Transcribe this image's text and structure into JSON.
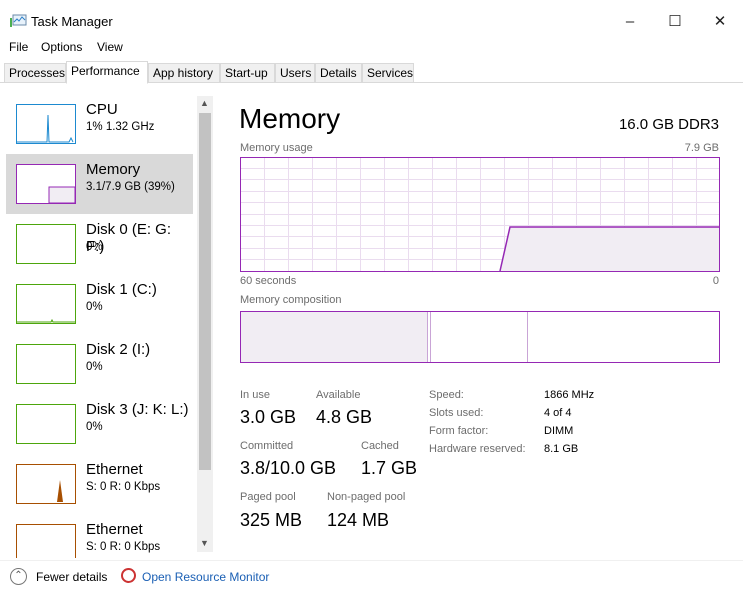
{
  "window": {
    "title": "Task Manager",
    "icon": "task-manager-icon"
  },
  "menu": [
    "File",
    "Options",
    "View"
  ],
  "tabs": [
    "Processes",
    "Performance",
    "App history",
    "Start-up",
    "Users",
    "Details",
    "Services"
  ],
  "active_tab": "Performance",
  "sidebar": [
    {
      "name": "CPU",
      "sub": "1% 1.32 GHz",
      "color": "#1d8ad0"
    },
    {
      "name": "Memory",
      "sub": "3.1/7.9 GB (39%)",
      "color": "#9528b4",
      "selected": true
    },
    {
      "name": "Disk 0 (E: G: F:)",
      "sub": "0%",
      "color": "#4da60c"
    },
    {
      "name": "Disk 1 (C:)",
      "sub": "0%",
      "color": "#4da60c"
    },
    {
      "name": "Disk 2 (I:)",
      "sub": "0%",
      "color": "#4da60c"
    },
    {
      "name": "Disk 3 (J: K: L:)",
      "sub": "0%",
      "color": "#4da60c"
    },
    {
      "name": "Ethernet",
      "sub": "S: 0 R: 0 Kbps",
      "color": "#a74f01"
    },
    {
      "name": "Ethernet",
      "sub": "S: 0 R: 0 Kbps",
      "color": "#a74f01"
    }
  ],
  "main": {
    "title": "Memory",
    "spec": "16.0 GB DDR3",
    "usage_label": "Memory usage",
    "usage_max": "7.9 GB",
    "time_left": "60 seconds",
    "time_right": "0",
    "composition_label": "Memory composition",
    "stats": {
      "in_use_label": "In use",
      "in_use": "3.0 GB",
      "available_label": "Available",
      "available": "4.8 GB",
      "committed_label": "Committed",
      "committed": "3.8/10.0 GB",
      "cached_label": "Cached",
      "cached": "1.7 GB",
      "paged_label": "Paged pool",
      "paged": "325 MB",
      "nonpaged_label": "Non-paged pool",
      "nonpaged": "124 MB"
    },
    "details": [
      [
        "Speed:",
        "1866 MHz"
      ],
      [
        "Slots used:",
        "4 of 4"
      ],
      [
        "Form factor:",
        "DIMM"
      ],
      [
        "Hardware reserved:",
        "8.1 GB"
      ]
    ]
  },
  "footer": {
    "fewer": "Fewer details",
    "monitor": "Open Resource Monitor"
  },
  "accent": "#9528b4"
}
